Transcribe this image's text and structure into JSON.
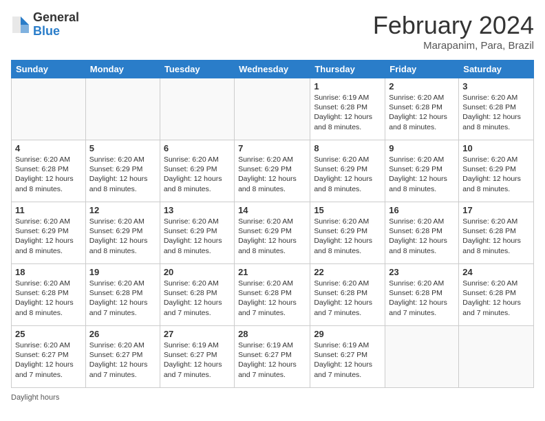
{
  "header": {
    "logo_general": "General",
    "logo_blue": "Blue",
    "title": "February 2024",
    "subtitle": "Marapanim, Para, Brazil"
  },
  "days_of_week": [
    "Sunday",
    "Monday",
    "Tuesday",
    "Wednesday",
    "Thursday",
    "Friday",
    "Saturday"
  ],
  "footer": {
    "daylight_label": "Daylight hours"
  },
  "weeks": [
    [
      {
        "day": "",
        "info": ""
      },
      {
        "day": "",
        "info": ""
      },
      {
        "day": "",
        "info": ""
      },
      {
        "day": "",
        "info": ""
      },
      {
        "day": "1",
        "info": "Sunrise: 6:19 AM\nSunset: 6:28 PM\nDaylight: 12 hours and 8 minutes."
      },
      {
        "day": "2",
        "info": "Sunrise: 6:20 AM\nSunset: 6:28 PM\nDaylight: 12 hours and 8 minutes."
      },
      {
        "day": "3",
        "info": "Sunrise: 6:20 AM\nSunset: 6:28 PM\nDaylight: 12 hours and 8 minutes."
      }
    ],
    [
      {
        "day": "4",
        "info": "Sunrise: 6:20 AM\nSunset: 6:28 PM\nDaylight: 12 hours and 8 minutes."
      },
      {
        "day": "5",
        "info": "Sunrise: 6:20 AM\nSunset: 6:29 PM\nDaylight: 12 hours and 8 minutes."
      },
      {
        "day": "6",
        "info": "Sunrise: 6:20 AM\nSunset: 6:29 PM\nDaylight: 12 hours and 8 minutes."
      },
      {
        "day": "7",
        "info": "Sunrise: 6:20 AM\nSunset: 6:29 PM\nDaylight: 12 hours and 8 minutes."
      },
      {
        "day": "8",
        "info": "Sunrise: 6:20 AM\nSunset: 6:29 PM\nDaylight: 12 hours and 8 minutes."
      },
      {
        "day": "9",
        "info": "Sunrise: 6:20 AM\nSunset: 6:29 PM\nDaylight: 12 hours and 8 minutes."
      },
      {
        "day": "10",
        "info": "Sunrise: 6:20 AM\nSunset: 6:29 PM\nDaylight: 12 hours and 8 minutes."
      }
    ],
    [
      {
        "day": "11",
        "info": "Sunrise: 6:20 AM\nSunset: 6:29 PM\nDaylight: 12 hours and 8 minutes."
      },
      {
        "day": "12",
        "info": "Sunrise: 6:20 AM\nSunset: 6:29 PM\nDaylight: 12 hours and 8 minutes."
      },
      {
        "day": "13",
        "info": "Sunrise: 6:20 AM\nSunset: 6:29 PM\nDaylight: 12 hours and 8 minutes."
      },
      {
        "day": "14",
        "info": "Sunrise: 6:20 AM\nSunset: 6:29 PM\nDaylight: 12 hours and 8 minutes."
      },
      {
        "day": "15",
        "info": "Sunrise: 6:20 AM\nSunset: 6:29 PM\nDaylight: 12 hours and 8 minutes."
      },
      {
        "day": "16",
        "info": "Sunrise: 6:20 AM\nSunset: 6:28 PM\nDaylight: 12 hours and 8 minutes."
      },
      {
        "day": "17",
        "info": "Sunrise: 6:20 AM\nSunset: 6:28 PM\nDaylight: 12 hours and 8 minutes."
      }
    ],
    [
      {
        "day": "18",
        "info": "Sunrise: 6:20 AM\nSunset: 6:28 PM\nDaylight: 12 hours and 8 minutes."
      },
      {
        "day": "19",
        "info": "Sunrise: 6:20 AM\nSunset: 6:28 PM\nDaylight: 12 hours and 7 minutes."
      },
      {
        "day": "20",
        "info": "Sunrise: 6:20 AM\nSunset: 6:28 PM\nDaylight: 12 hours and 7 minutes."
      },
      {
        "day": "21",
        "info": "Sunrise: 6:20 AM\nSunset: 6:28 PM\nDaylight: 12 hours and 7 minutes."
      },
      {
        "day": "22",
        "info": "Sunrise: 6:20 AM\nSunset: 6:28 PM\nDaylight: 12 hours and 7 minutes."
      },
      {
        "day": "23",
        "info": "Sunrise: 6:20 AM\nSunset: 6:28 PM\nDaylight: 12 hours and 7 minutes."
      },
      {
        "day": "24",
        "info": "Sunrise: 6:20 AM\nSunset: 6:28 PM\nDaylight: 12 hours and 7 minutes."
      }
    ],
    [
      {
        "day": "25",
        "info": "Sunrise: 6:20 AM\nSunset: 6:27 PM\nDaylight: 12 hours and 7 minutes."
      },
      {
        "day": "26",
        "info": "Sunrise: 6:20 AM\nSunset: 6:27 PM\nDaylight: 12 hours and 7 minutes."
      },
      {
        "day": "27",
        "info": "Sunrise: 6:19 AM\nSunset: 6:27 PM\nDaylight: 12 hours and 7 minutes."
      },
      {
        "day": "28",
        "info": "Sunrise: 6:19 AM\nSunset: 6:27 PM\nDaylight: 12 hours and 7 minutes."
      },
      {
        "day": "29",
        "info": "Sunrise: 6:19 AM\nSunset: 6:27 PM\nDaylight: 12 hours and 7 minutes."
      },
      {
        "day": "",
        "info": ""
      },
      {
        "day": "",
        "info": ""
      }
    ]
  ]
}
